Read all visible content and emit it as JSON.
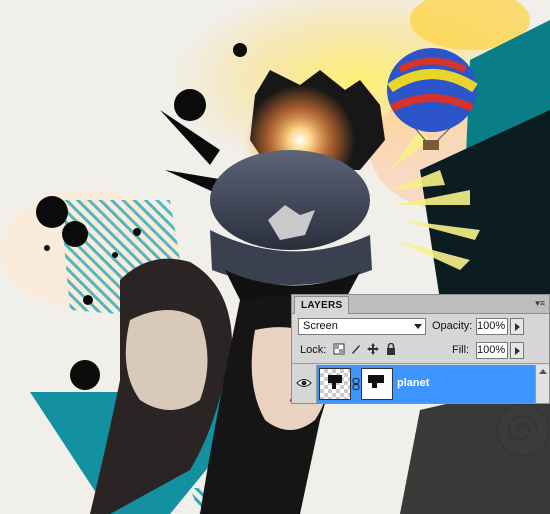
{
  "panel": {
    "tab_label": "LAYERS",
    "menu_icon": "panel-menu-icon",
    "blend_mode": "Screen",
    "opacity_label": "Opacity:",
    "opacity_value": "100%",
    "lock_label": "Lock:",
    "fill_label": "Fill:",
    "fill_value": "100%",
    "layers": [
      {
        "name": "planet",
        "visible": true,
        "selected": true
      }
    ]
  },
  "colors": {
    "selection": "#3d95ff",
    "teal": "#0e8f98",
    "panel_bg": "#d6d6d6"
  }
}
